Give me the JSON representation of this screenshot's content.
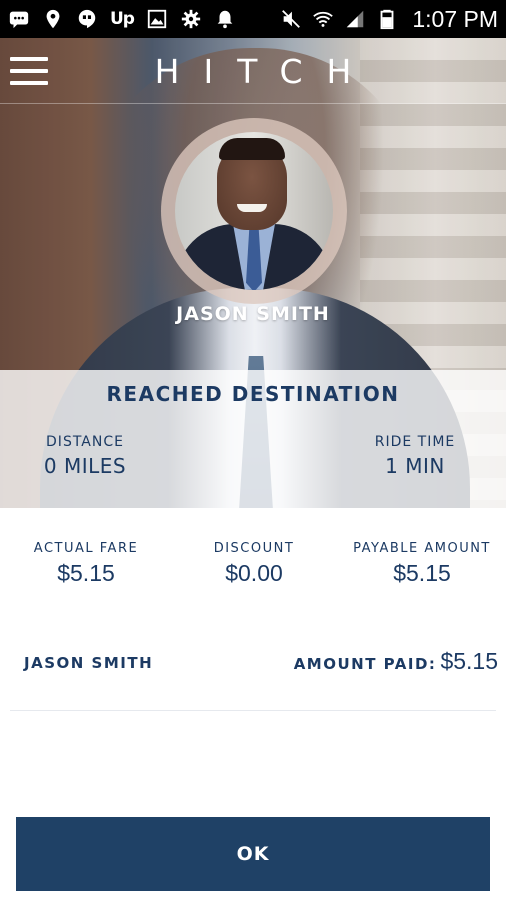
{
  "status_bar": {
    "time": "1:07 PM",
    "carrier_app_label": "Up",
    "icons": [
      "message-icon",
      "location-icon",
      "hangouts-icon",
      "up-app-icon",
      "image-icon",
      "settings-icon",
      "notification-bell-icon",
      "mute-icon",
      "wifi-icon",
      "signal-icon",
      "battery-icon"
    ]
  },
  "app_bar": {
    "title": "HITCH",
    "menu_icon": "hamburger-menu-icon"
  },
  "driver": {
    "name": "JASON SMITH"
  },
  "trip_status": {
    "title": "REACHED DESTINATION",
    "distance_label": "DISTANCE",
    "distance_value": "0 MILES",
    "ride_time_label": "RIDE TIME",
    "ride_time_value": "1 MIN"
  },
  "fare": {
    "actual_label": "ACTUAL FARE",
    "actual_value": "$5.15",
    "discount_label": "DISCOUNT",
    "discount_value": "$0.00",
    "payable_label": "PAYABLE AMOUNT",
    "payable_value": "$5.15"
  },
  "summary": {
    "name": "JASON SMITH",
    "amount_paid_label": "AMOUNT PAID:",
    "amount_paid_value": "$5.15"
  },
  "actions": {
    "ok_label": "OK"
  },
  "colors": {
    "brand_navy": "#1c3a63",
    "button_navy": "#1f4166"
  }
}
